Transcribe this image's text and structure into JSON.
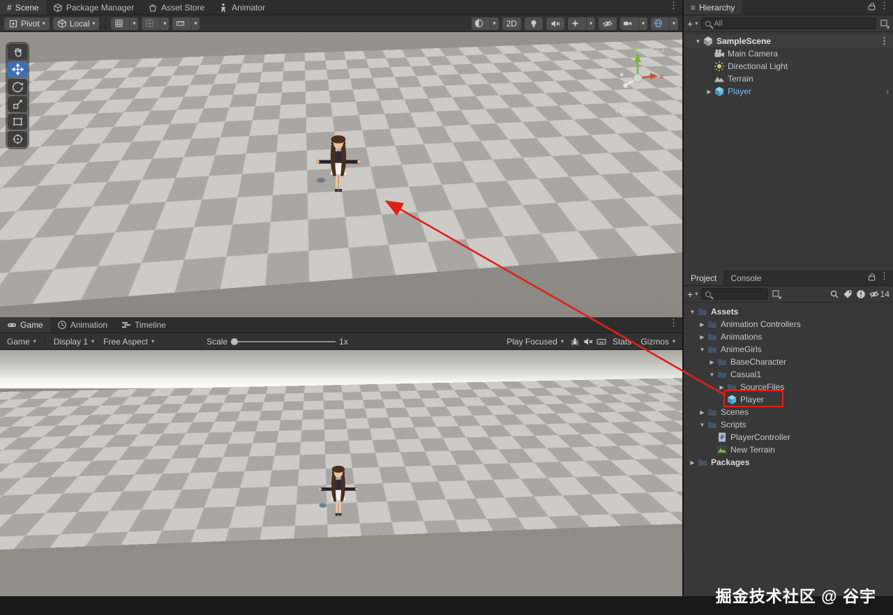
{
  "icons": {
    "menu_vertical": "⋮",
    "caret_down": "▾",
    "tree_down": "▼",
    "tree_right": "▶",
    "hamburger": "≡",
    "plus": "+",
    "hash": "#",
    "chevron_left": "‹",
    "chevron_right": "›"
  },
  "scene_tabs": {
    "scene": "Scene",
    "package_manager": "Package Manager",
    "asset_store": "Asset Store",
    "animator": "Animator"
  },
  "scene_toolbar": {
    "pivot": "Pivot",
    "local": "Local",
    "two_d": "2D"
  },
  "scene_view": {
    "persp_label": "Persp",
    "axis_x": "x",
    "axis_y": "y"
  },
  "hierarchy": {
    "title": "Hierarchy",
    "search_placeholder": "All",
    "scene_root": "SampleScene",
    "items": [
      {
        "label": "Main Camera"
      },
      {
        "label": "Directional Light"
      },
      {
        "label": "Terrain"
      },
      {
        "label": "Player"
      }
    ]
  },
  "project": {
    "tab_project": "Project",
    "tab_console": "Console",
    "hidden_count": "14",
    "tree": {
      "assets": "Assets",
      "animation_controllers": "Animation Controllers",
      "animations": "Animations",
      "animegirls": "AnimeGirls",
      "basecharacter": "BaseCharacter",
      "casual1": "Casual1",
      "sourcefiles": "SourceFiles",
      "player": "Player",
      "scenes": "Scenes",
      "scripts": "Scripts",
      "playercontroller": "PlayerController",
      "new_terrain": "New Terrain",
      "packages": "Packages"
    }
  },
  "game_tabs": {
    "game": "Game",
    "animation": "Animation",
    "timeline": "Timeline"
  },
  "game_toolbar": {
    "game_dropdown": "Game",
    "display": "Display 1",
    "aspect": "Free Aspect",
    "scale_label": "Scale",
    "scale_value": "1x",
    "play_focused": "Play Focused",
    "stats": "Stats",
    "gizmos": "Gizmos"
  },
  "watermark": "掘金技术社区 @ 谷宇"
}
